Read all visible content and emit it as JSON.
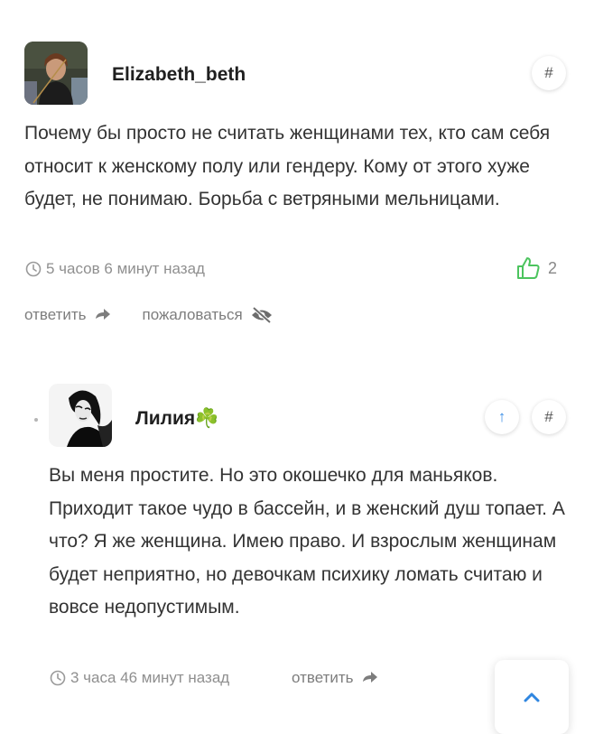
{
  "comments": [
    {
      "author": "Elizabeth_beth",
      "anchor": "#",
      "text": "Почему бы просто не считать женщинами тех, кто сам себя относит к женскому полу или гендеру. Кому от этого хуже будет, не понимаю. Борьба с ветряными мельницами.",
      "time": "5 часов 6 минут назад",
      "likes": "2",
      "reply_label": "ответить",
      "report_label": "пожаловаться"
    },
    {
      "author": "Лилия",
      "author_emoji": "☘️",
      "anchor": "#",
      "up": "↑",
      "text": "Вы меня простите. Но это окошечко для маньяков. Приходит такое чудо в бассейн, и в женский душ топает. А что? Я же женщина. Имею право. И взрослым женщинам будет неприятно, но девочкам психику ломать считаю и вовсе недопустимым.",
      "time": "3 часа 46 минут назад",
      "reply_label": "ответить"
    }
  ],
  "colors": {
    "like_green": "#4cc45e",
    "up_blue": "#3a8ee6",
    "scroll_blue": "#2f86e0"
  }
}
